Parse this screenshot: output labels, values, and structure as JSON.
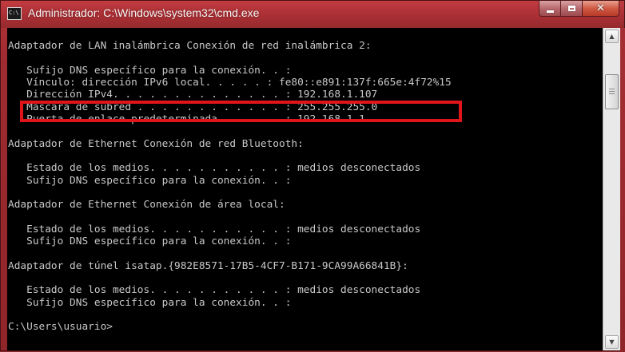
{
  "window": {
    "title": "Administrador: C:\\Windows\\system32\\cmd.exe",
    "icon": "cmd-icon",
    "icon_text": "C:\\",
    "buttons": {
      "minimize": "minimize-icon",
      "maximize": "maximize-icon",
      "close": "close-icon",
      "close_glyph": "✕"
    }
  },
  "console": {
    "lines": [
      "",
      "Adaptador de LAN inalámbrica Conexión de red inalámbrica 2:",
      "",
      "   Sufijo DNS específico para la conexión. . :",
      "   Vínculo: dirección IPv6 local. . . . . : fe80::e891:137f:665e:4f72%15",
      "   Dirección IPv4. . . . . . . . . . . . . . : 192.168.1.107",
      "   Máscara de subred . . . . . . . . . . . . : 255.255.255.0",
      "   Puerta de enlace predeterminada . . . . . : 192.168.1.1",
      "",
      "Adaptador de Ethernet Conexión de red Bluetooth:",
      "",
      "   Estado de los medios. . . . . . . . . . . : medios desconectados",
      "   Sufijo DNS específico para la conexión. . :",
      "",
      "Adaptador de Ethernet Conexión de área local:",
      "",
      "   Estado de los medios. . . . . . . . . . . : medios desconectados",
      "   Sufijo DNS específico para la conexión. . :",
      "",
      "Adaptador de túnel isatap.{982E8571-17B5-4CF7-B171-9CA99A66841B}:",
      "",
      "   Estado de los medios. . . . . . . . . . . : medios desconectados",
      "   Sufijo DNS específico para la conexión. . :",
      "",
      "C:\\Users\\usuario>"
    ],
    "text_color": "#c8c8c8",
    "background": "#000000"
  },
  "highlight": {
    "label": "Dirección IPv4",
    "color": "#e0151b"
  },
  "scrollbar": {
    "up_glyph": "▲",
    "down_glyph": "▼"
  }
}
